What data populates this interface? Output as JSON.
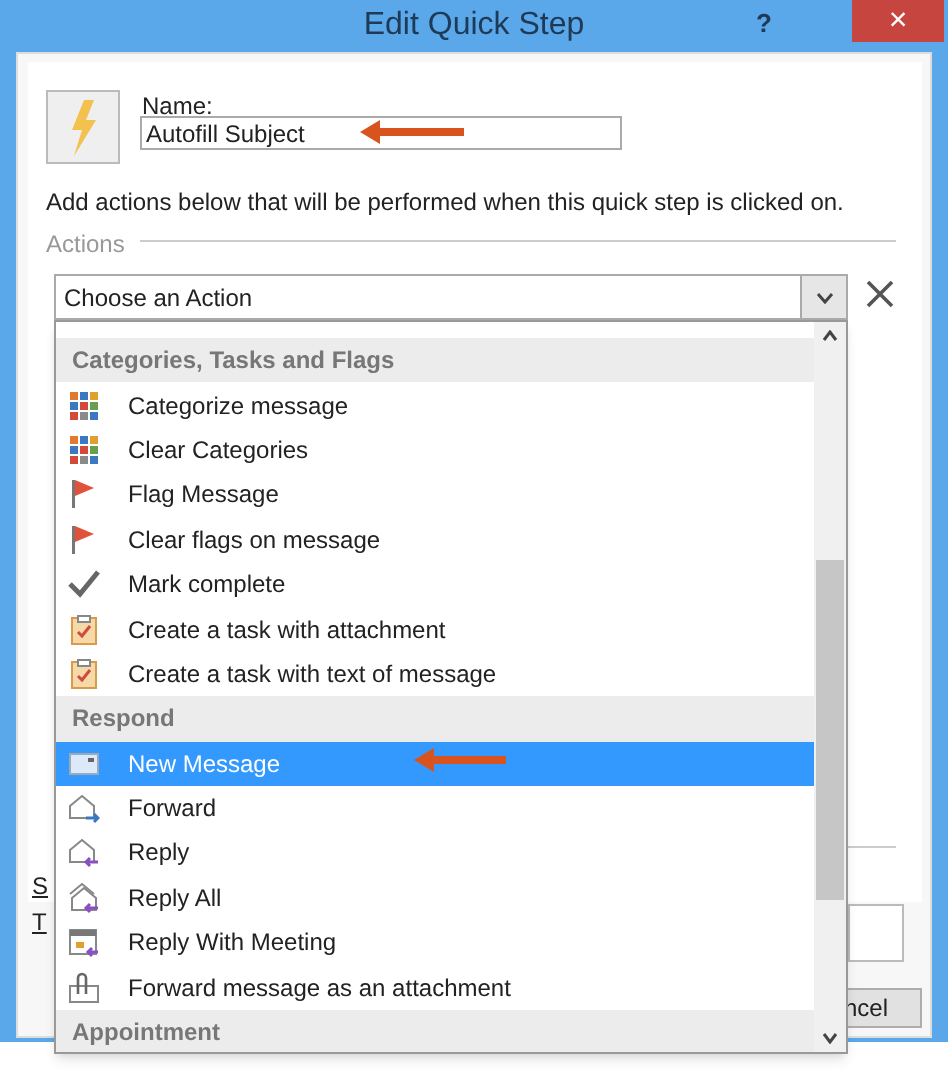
{
  "window": {
    "title": "Edit Quick Step",
    "help": "?",
    "close": "×"
  },
  "name_label": "Name:",
  "name_value": "Autofill Subject",
  "description": "Add actions below that will be performed when this quick step is clicked on.",
  "actions_label": "Actions",
  "action_combo": {
    "value": "Choose an Action"
  },
  "dropdown": {
    "groups": [
      {
        "header": "Categories, Tasks and Flags",
        "items": [
          {
            "label": "Categorize message",
            "kind": "categories",
            "selected": false
          },
          {
            "label": "Clear Categories",
            "kind": "categories",
            "selected": false
          },
          {
            "label": "Flag Message",
            "kind": "flag",
            "selected": false
          },
          {
            "label": "Clear flags on message",
            "kind": "flag",
            "selected": false
          },
          {
            "label": "Mark complete",
            "kind": "check",
            "selected": false
          },
          {
            "label": "Create a task with attachment",
            "kind": "task",
            "selected": false
          },
          {
            "label": "Create a task with text of message",
            "kind": "task",
            "selected": false
          }
        ]
      },
      {
        "header": "Respond",
        "items": [
          {
            "label": "New Message",
            "kind": "new-message",
            "selected": true
          },
          {
            "label": "Forward",
            "kind": "forward",
            "selected": false
          },
          {
            "label": "Reply",
            "kind": "reply",
            "selected": false
          },
          {
            "label": "Reply All",
            "kind": "reply-all",
            "selected": false
          },
          {
            "label": "Reply With Meeting",
            "kind": "meeting",
            "selected": false
          },
          {
            "label": "Forward message as an attachment",
            "kind": "attach",
            "selected": false
          }
        ]
      },
      {
        "header": "Appointment"
      }
    ]
  },
  "background": {
    "fragments": [
      "S",
      "T"
    ],
    "cancel_button": "ncel"
  }
}
